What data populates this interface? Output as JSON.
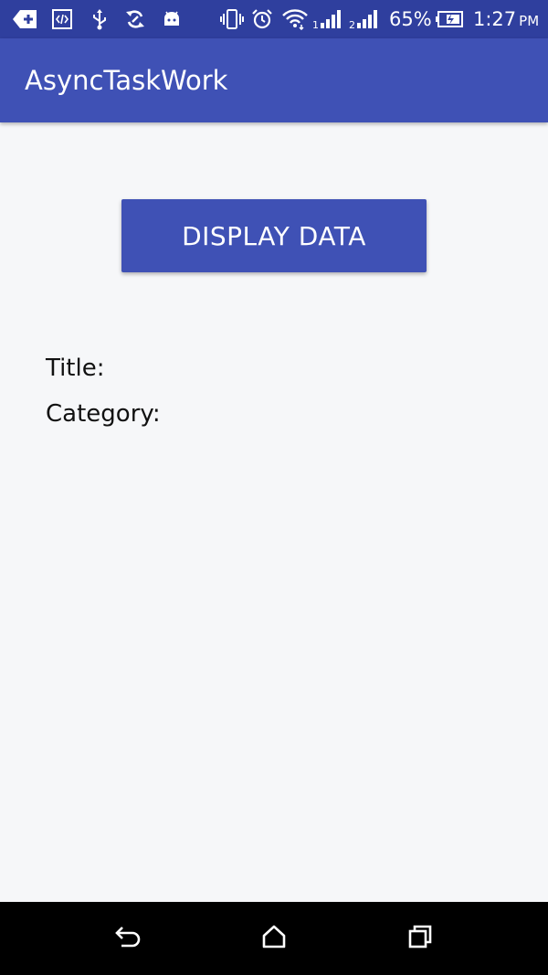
{
  "status_bar": {
    "battery_percent": "65%",
    "time": "1:27",
    "ampm": "PM",
    "icons": [
      "add-icon",
      "code-icon",
      "usb-icon",
      "sync-icon",
      "android-icon",
      "vibrate-icon",
      "alarm-icon",
      "wifi-icon",
      "signal-1-icon",
      "signal-2-icon",
      "battery-icon"
    ]
  },
  "toolbar": {
    "title": "AsyncTaskWork"
  },
  "main": {
    "display_button_label": "DISPLAY DATA",
    "title_label": "Title:",
    "category_label": "Category:"
  },
  "nav_bar": {
    "icons": [
      "back-icon",
      "home-icon",
      "recents-icon"
    ]
  },
  "colors": {
    "primary": "#3f51b5",
    "primary_dark": "#2f3f9e",
    "background": "#f6f7f9",
    "nav_bar": "#000000"
  }
}
